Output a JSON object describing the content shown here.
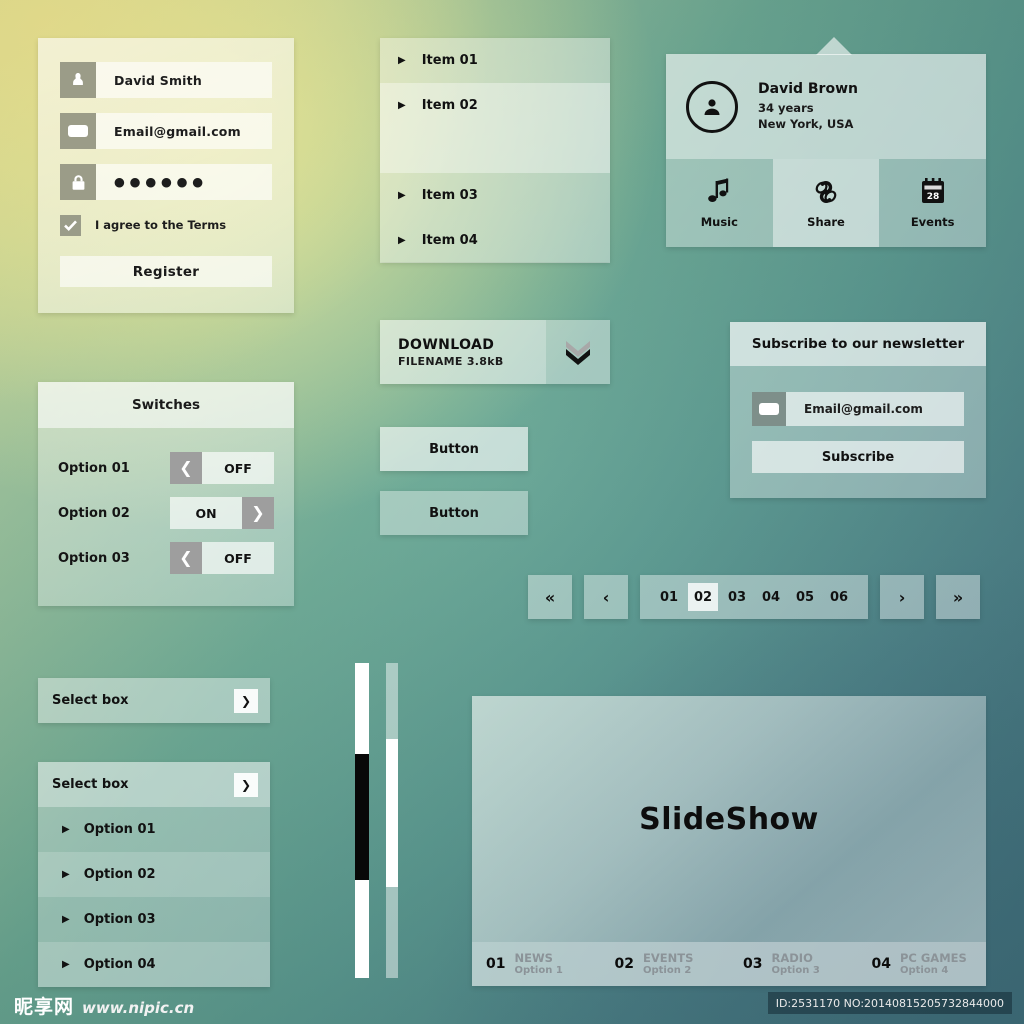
{
  "background": {
    "top_left_color": "#f0e891",
    "mid_color": "#62a394",
    "bottom_right_color": "#3f6f7c"
  },
  "register_form": {
    "name_value": "David Smith",
    "name_icon": "user-icon",
    "email_value": "Email@gmail.com",
    "email_icon": "envelope-icon",
    "password_value": "● ● ● ● ● ●",
    "password_icon": "lock-icon",
    "checkbox_label": "I agree to the Terms",
    "checkbox_checked": true,
    "submit_label": "Register"
  },
  "switches": {
    "title": "Switches",
    "rows": [
      {
        "label": "Option 01",
        "state": "OFF",
        "on": false
      },
      {
        "label": "Option 02",
        "state": "ON",
        "on": true
      },
      {
        "label": "Option 03",
        "state": "OFF",
        "on": false
      }
    ]
  },
  "select_collapsed": {
    "label": "Select box",
    "caret_icon": "chevron-down-icon"
  },
  "select_expanded": {
    "label": "Select box",
    "caret_icon": "chevron-down-icon",
    "options": [
      "Option 01",
      "Option 02",
      "Option 03",
      "Option 04"
    ]
  },
  "item_list": {
    "items": [
      "Item 01",
      "Item 02",
      "Item 03",
      "Item 04"
    ],
    "bullet_icon": "triangle-right-icon"
  },
  "download": {
    "title": "DOWNLOAD",
    "subtitle": "FILENAME 3.8kB",
    "button_icon": "double-chevron-down-icon"
  },
  "buttons": {
    "primary_label": "Button",
    "secondary_label": "Button"
  },
  "profile_card": {
    "avatar_icon": "user-avatar-icon",
    "name": "David Brown",
    "age": "34 years",
    "location": "New York, USA",
    "actions": [
      {
        "label": "Music",
        "icon": "music-note-icon",
        "selected": false
      },
      {
        "label": "Share",
        "icon": "chain-link-icon",
        "selected": true
      },
      {
        "label": "Events",
        "icon": "calendar-icon",
        "selected": false
      }
    ]
  },
  "newsletter": {
    "title": "Subscribe to our newsletter",
    "email_value": "Email@gmail.com",
    "email_icon": "envelope-icon",
    "button_label": "Subscribe"
  },
  "pagination": {
    "first_label": "«",
    "prev_label": "‹",
    "next_label": "›",
    "last_label": "»",
    "pages": [
      "01",
      "02",
      "03",
      "04",
      "05",
      "06"
    ],
    "active_page": "02"
  },
  "scrollbars": {
    "dark": {
      "track_color": "#ffffff",
      "thumb_color": "#080808"
    },
    "light": {
      "track_color": "#b7cfcb",
      "thumb_color": "#ffffff"
    }
  },
  "slideshow": {
    "title": "SlideShow",
    "thumbs": [
      {
        "num": "01",
        "title": "NEWS",
        "sub": "Option 1"
      },
      {
        "num": "02",
        "title": "EVENTS",
        "sub": "Option 2"
      },
      {
        "num": "03",
        "title": "RADIO",
        "sub": "Option 3"
      },
      {
        "num": "04",
        "title": "PC GAMES",
        "sub": "Option 4"
      }
    ]
  },
  "watermark": {
    "logo_cn": "昵享网",
    "url": "www.nipic.cn",
    "id_text": "ID:2531170 NO:20140815205732844000"
  }
}
